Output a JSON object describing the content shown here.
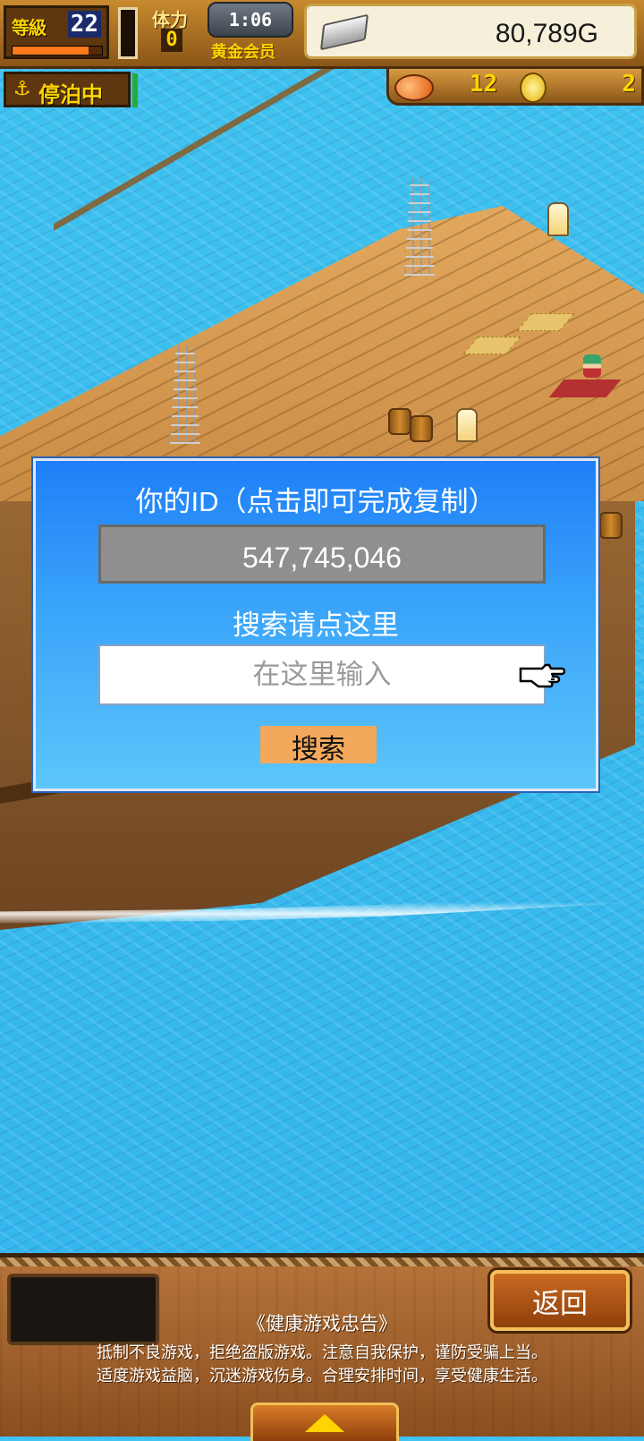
{
  "hud": {
    "level_label": "等級",
    "level_value": "22",
    "exp_fraction": 0.85,
    "stamina_label": "体力",
    "stamina_value": "0",
    "stamina_fraction": 0,
    "timer": "1:06",
    "member_label": "黄金会员",
    "gold": "80,789G",
    "icons": {
      "silver": "silver-bar-icon",
      "anchor": "anchor-icon",
      "fish": "fish-icon",
      "coin": "coin-icon"
    }
  },
  "status": {
    "anchor_symbol": "⚓",
    "label": "停泊中"
  },
  "currency": {
    "fish_count": "12",
    "coin_count": "2"
  },
  "dialog": {
    "title": "你的ID（点击即可完成复制）",
    "id_value": "547,745,046",
    "search_label": "搜索请点这里",
    "search_placeholder": "在这里输入",
    "search_value": "",
    "search_button": "搜索",
    "colors": {
      "top": "#1f7ff8",
      "bottom": "#5cc6fb",
      "button": "#f3a95c",
      "id_box": "#8f8f8f"
    }
  },
  "bottom": {
    "back_button": "返回",
    "notice_title": "《健康游戏忠告》",
    "notice_line1": "抵制不良游戏，拒绝盗版游戏。注意自我保护，谨防受骗上当。",
    "notice_line2": "适度游戏益脑，沉迷游戏伤身。合理安排时间，享受健康生活。"
  }
}
